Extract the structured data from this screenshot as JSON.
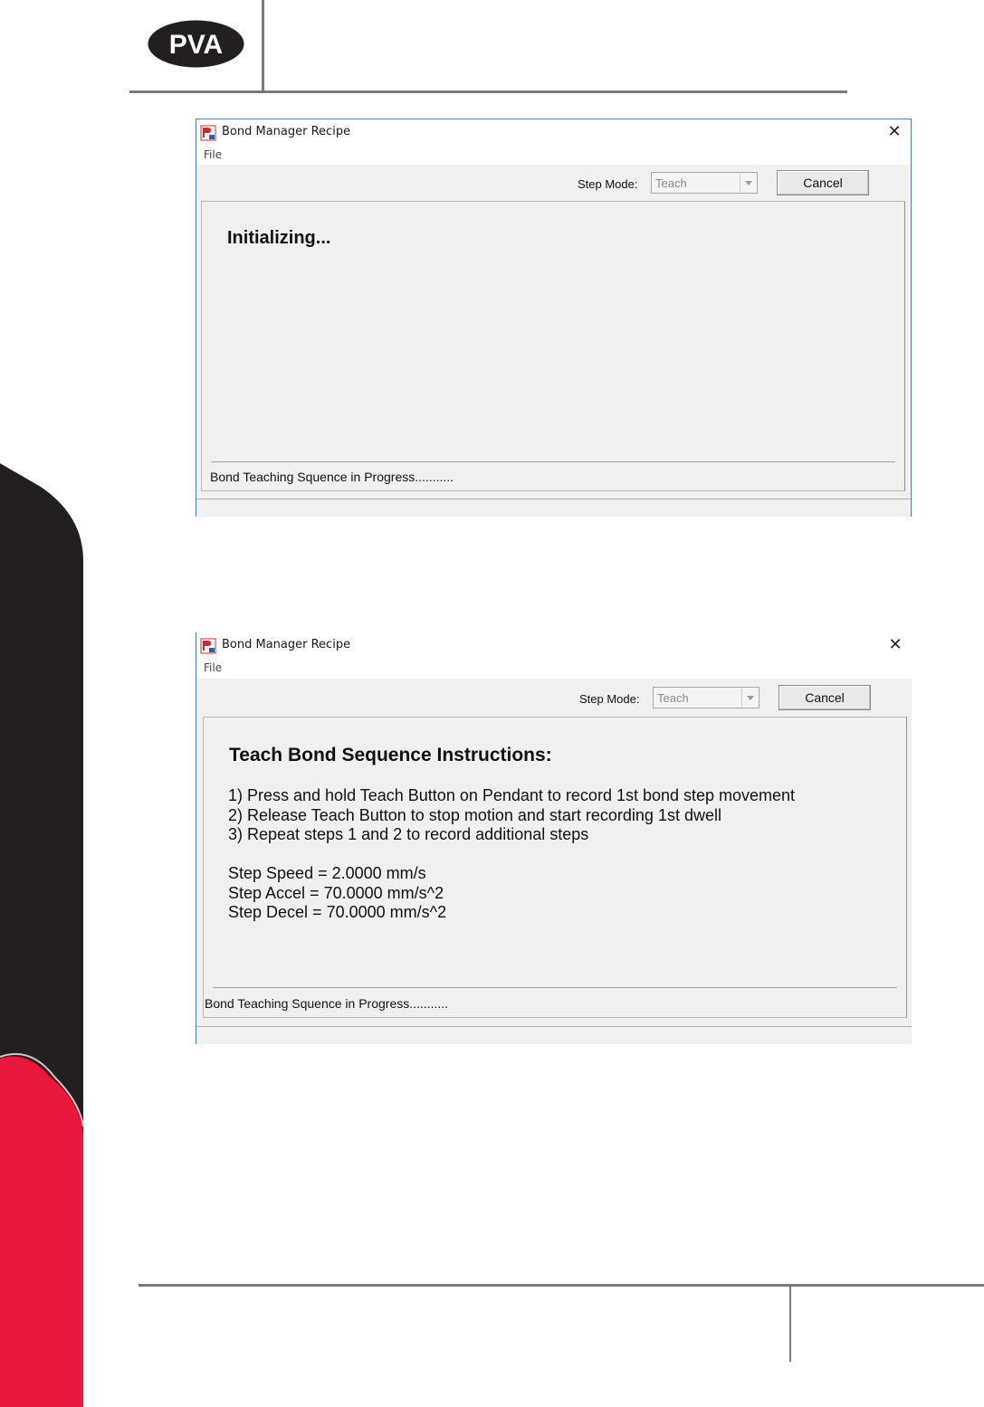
{
  "logo": {
    "text": "PVA"
  },
  "dialogs": [
    {
      "title": "Bond Manager Recipe",
      "menu_file": "File",
      "step_mode_label": "Step Mode:",
      "step_mode_value": "Teach",
      "cancel_label": "Cancel",
      "heading": "Initializing...",
      "status": "Bond Teaching Squence in Progress..........."
    },
    {
      "title": "Bond Manager Recipe",
      "menu_file": "File",
      "step_mode_label": "Step Mode:",
      "step_mode_value": "Teach",
      "cancel_label": "Cancel",
      "heading": "Teach Bond Sequence Instructions:",
      "instructions": [
        "1) Press and hold Teach Button on Pendant to record 1st bond step movement",
        "2) Release Teach Button to stop motion and start recording 1st dwell",
        "3) Repeat steps 1 and 2 to record additional steps"
      ],
      "parameters": [
        "Step Speed = 2.0000 mm/s",
        "Step Accel = 70.0000 mm/s^2",
        "Step Decel = 70.0000 mm/s^2"
      ],
      "status": "Bond Teaching Squence in Progress..........."
    }
  ],
  "colors": {
    "brand_red": "#e8193c",
    "brand_dark": "#231f20",
    "rule_gray": "#7a7a7a"
  }
}
